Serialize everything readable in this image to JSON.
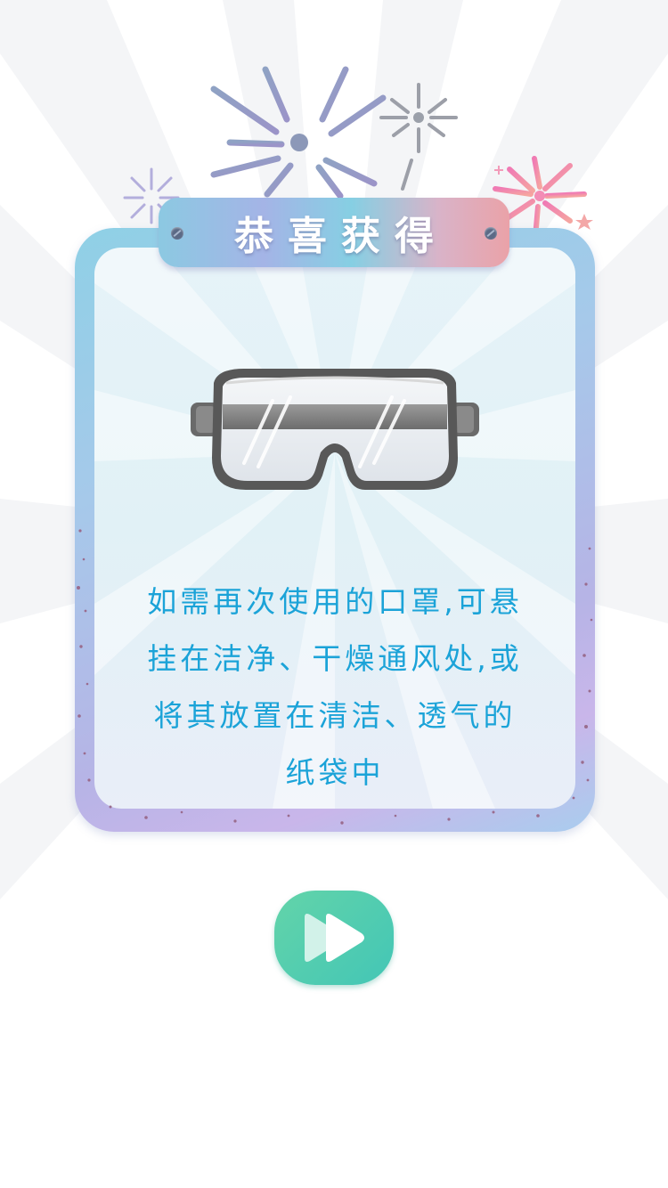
{
  "title": "恭喜获得",
  "item": {
    "name": "goggles"
  },
  "message_lines": [
    "如需再次使用的口罩,可悬",
    "挂在洁净、干燥通风处,或",
    "将其放置在清洁、透气的",
    "纸袋中"
  ],
  "next_button": {
    "icon": "fast-forward-icon"
  },
  "colors": {
    "message_text": "#1ba3d8",
    "button": "#4fcaae",
    "frame": "#a6c9ea"
  }
}
